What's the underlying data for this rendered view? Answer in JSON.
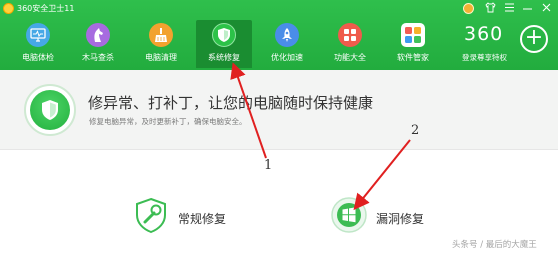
{
  "window": {
    "title": "360安全卫士11",
    "title_icons": [
      "medal-icon",
      "shirt-icon",
      "menu-icon",
      "minimize-icon",
      "close-icon"
    ]
  },
  "nav": {
    "items": [
      {
        "label": "电脑体检",
        "icon": "monitor-check-icon",
        "active": false
      },
      {
        "label": "木马查杀",
        "icon": "horse-icon",
        "active": false
      },
      {
        "label": "电脑清理",
        "icon": "broom-icon",
        "active": false
      },
      {
        "label": "系统修复",
        "icon": "shield-icon",
        "active": true
      },
      {
        "label": "优化加速",
        "icon": "rocket-icon",
        "active": false
      },
      {
        "label": "功能大全",
        "icon": "grid-icon",
        "active": false
      },
      {
        "label": "软件管家",
        "icon": "apps-icon",
        "active": false
      }
    ],
    "active_color": "#1a8d31"
  },
  "brand": {
    "logo_text": "360",
    "subtitle": "登录尊享特权"
  },
  "banner": {
    "headline": "修异常、打补丁，让您的电脑随时保持健康",
    "subtext": "修复电脑异常，及时更新补丁，确保电脑安全。"
  },
  "actions": {
    "routine_repair": "常规修复",
    "vulnerability_repair": "漏洞修复"
  },
  "annotations": {
    "callout_1": "1",
    "callout_2": "2",
    "arrow_color": "#e02020"
  },
  "watermark": "头条号 / 最后的大魔王",
  "colors": {
    "brand_green": "#2fbf4c",
    "icon_green": "#23b13e"
  }
}
